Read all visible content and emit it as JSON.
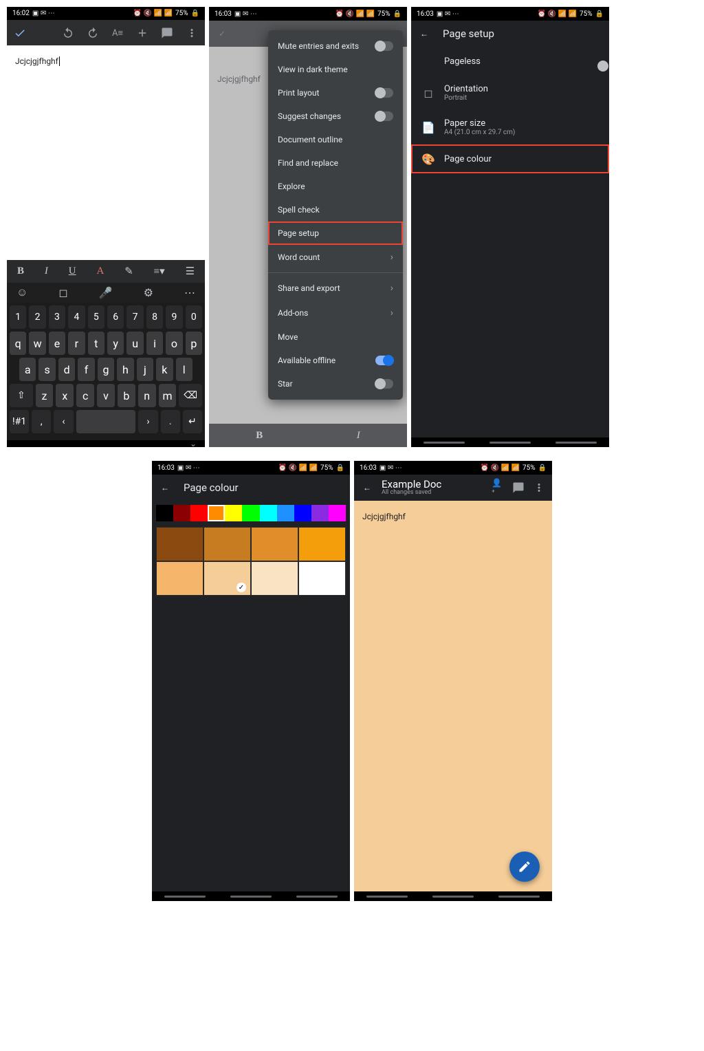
{
  "status": {
    "times": [
      "16:02",
      "16:03",
      "16:03",
      "16:03",
      "16:03"
    ],
    "right_text": "75%"
  },
  "document_text": "Jcjcjgjfhghf",
  "format_bar": {
    "bold": "B",
    "italic": "I",
    "underline": "U",
    "textcolor": "A",
    "highlight": "✎",
    "align": "≡",
    "list": "☰"
  },
  "keyboard": {
    "numbers": [
      "1",
      "2",
      "3",
      "4",
      "5",
      "6",
      "7",
      "8",
      "9",
      "0"
    ],
    "row1": [
      "q",
      "w",
      "e",
      "r",
      "t",
      "y",
      "u",
      "i",
      "o",
      "p"
    ],
    "row2": [
      "a",
      "s",
      "d",
      "f",
      "g",
      "h",
      "j",
      "k",
      "l"
    ],
    "row3_fn_left": "⇧",
    "row3": [
      "z",
      "x",
      "c",
      "v",
      "b",
      "n",
      "m"
    ],
    "row3_fn_right": "⌫",
    "bottom": {
      "sym": "!#1",
      "comma": ",",
      "left": "‹",
      "right": "›",
      "dot": ".",
      "enter": "↵"
    }
  },
  "menu": {
    "items": [
      {
        "label": "Mute entries and exits",
        "trail": "toggle-off"
      },
      {
        "label": "View in dark theme",
        "trail": ""
      },
      {
        "label": "Print layout",
        "trail": "toggle-off"
      },
      {
        "label": "Suggest changes",
        "trail": "toggle-off"
      },
      {
        "label": "Document outline",
        "trail": ""
      },
      {
        "label": "Find and replace",
        "trail": ""
      },
      {
        "label": "Explore",
        "trail": ""
      },
      {
        "label": "Spell check",
        "trail": ""
      },
      {
        "label": "Page setup",
        "trail": "",
        "highlight": true
      },
      {
        "label": "Word count",
        "trail": "chev"
      },
      {
        "label": "Share and export",
        "trail": "chev",
        "divider_before": true
      },
      {
        "label": "Add-ons",
        "trail": "chev"
      },
      {
        "label": "Move",
        "trail": ""
      },
      {
        "label": "Available offline",
        "trail": "toggle-on"
      },
      {
        "label": "Star",
        "trail": "toggle-off"
      }
    ]
  },
  "page_setup": {
    "title": "Page setup",
    "pageless": "Pageless",
    "orientation_label": "Orientation",
    "orientation_value": "Portrait",
    "paper_label": "Paper size",
    "paper_value": "A4 (21.0 cm x 29.7 cm)",
    "page_colour": "Page colour"
  },
  "colour_picker": {
    "title": "Page colour",
    "base_colors": [
      "#000000",
      "#8B0000",
      "#ff0000",
      "#ff8c00",
      "#ffff00",
      "#00ff00",
      "#00ffff",
      "#1e90ff",
      "#0000ff",
      "#8a2be2",
      "#ff00ff"
    ],
    "shades_row1": [
      "#8a4a10",
      "#c77c22",
      "#e08e2a",
      "#f59e0b"
    ],
    "shades_row2": [
      "#f5b66b",
      "#f4cd98",
      "#fae3c3",
      "#ffffff"
    ],
    "selected_index": 1
  },
  "result_doc": {
    "title": "Example Doc",
    "subtitle": "All changes saved",
    "body": "Jcjcjgjfhghf",
    "bg": "#f4cd98"
  }
}
